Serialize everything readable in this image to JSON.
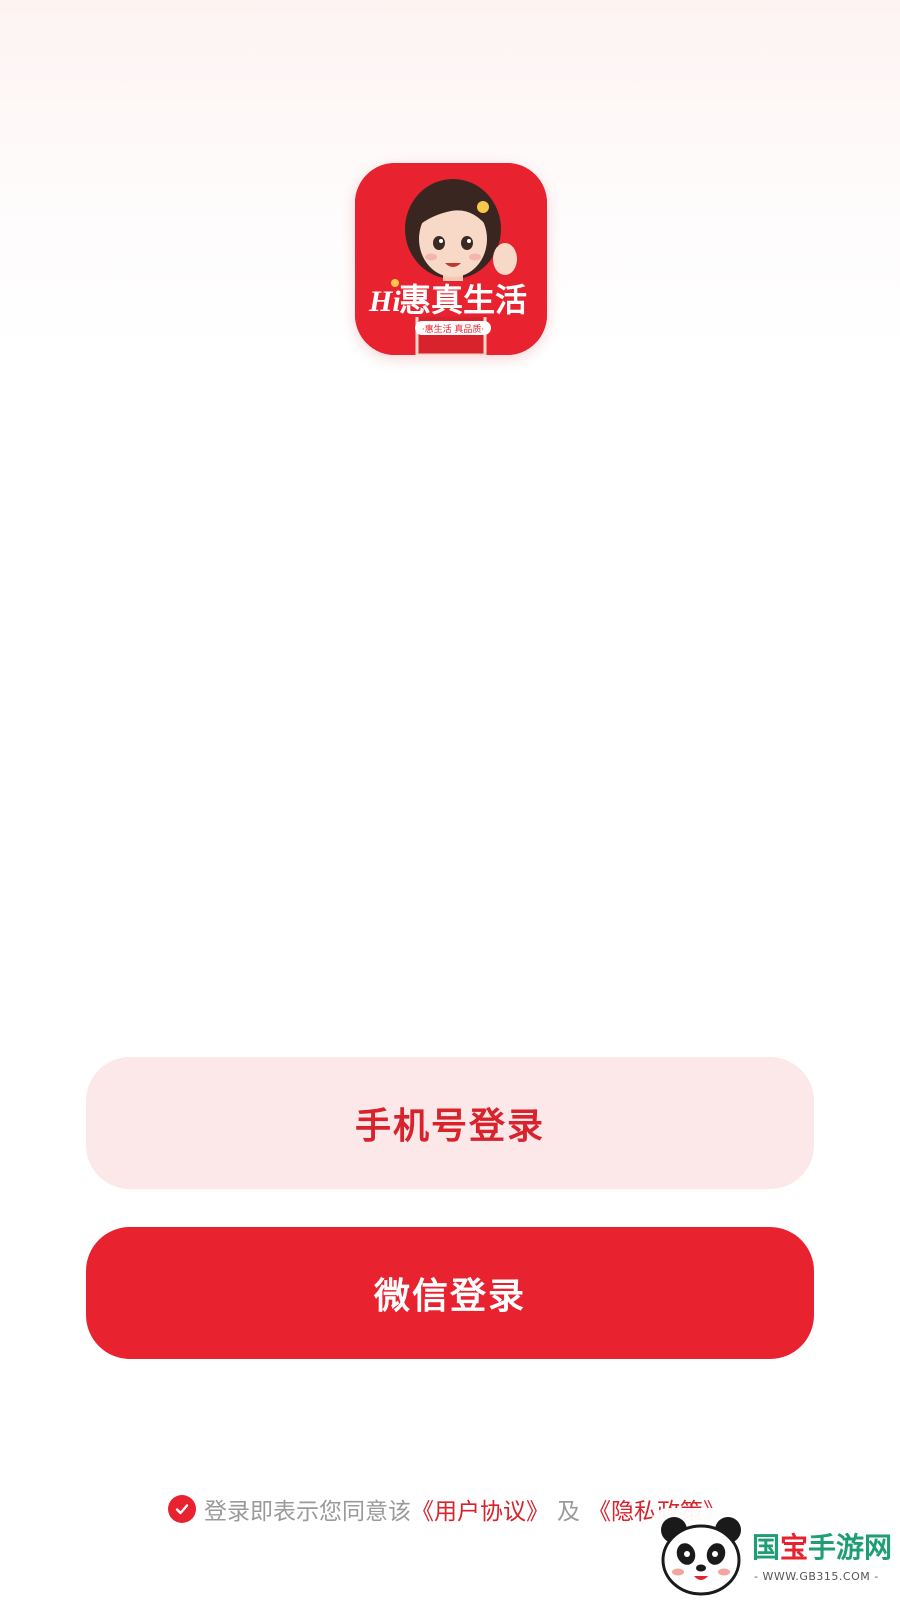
{
  "app": {
    "logo_text": "惠真生活",
    "logo_prefix": "Hi",
    "logo_slogan": "·惠生活 真品质·"
  },
  "buttons": {
    "phone_login": "手机号登录",
    "wechat_login": "微信登录"
  },
  "agreement": {
    "checked": true,
    "prefix": "登录即表示您同意该",
    "user_agreement": "《用户协议》",
    "and": "及",
    "privacy_policy": "《隐私政策》"
  },
  "watermark": {
    "name_part1": "国",
    "name_part2": "宝",
    "name_part3": "手游网",
    "url": "- WWW.GB315.COM -"
  },
  "colors": {
    "brand_red": "#e8222e",
    "light_red_button": "#fce8e9",
    "muted_text": "#9a9a9a"
  }
}
